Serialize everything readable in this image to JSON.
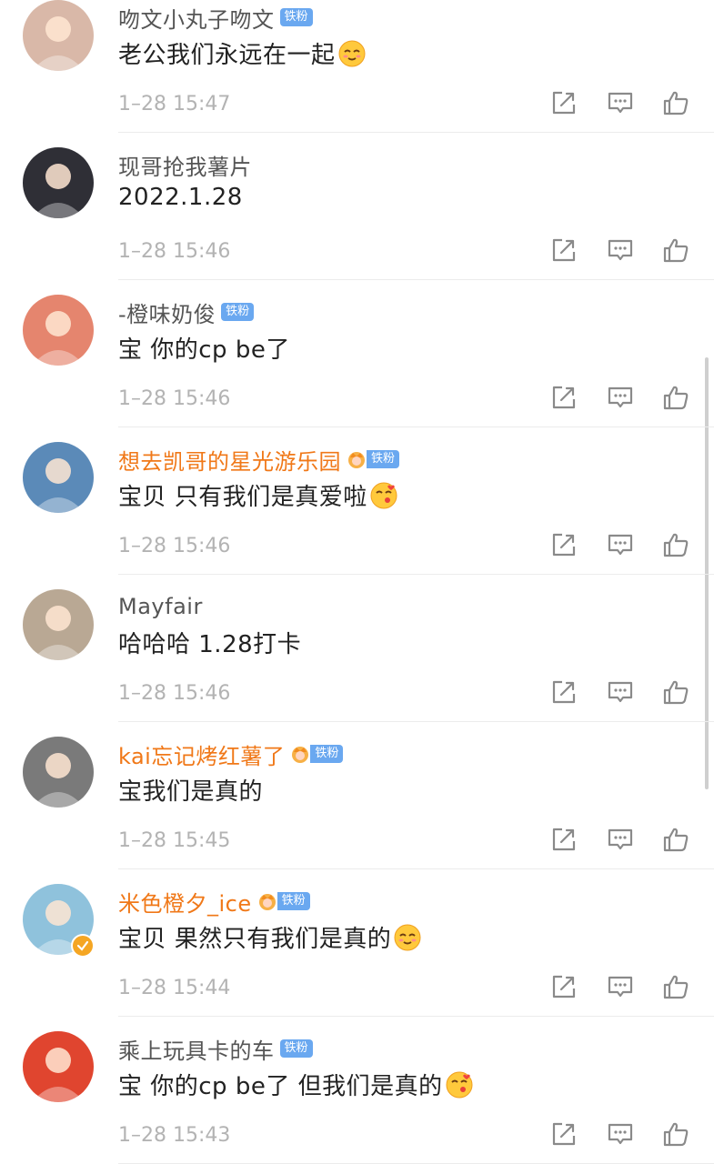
{
  "comments": [
    {
      "username": "吻文小丸子吻文",
      "vip": false,
      "crown": false,
      "fan_badge": "铁粉",
      "content": "老公我们永远在一起",
      "emoji": "smile-emoji",
      "time": "1–28 15:47",
      "avatar_color": "#d9b8a8"
    },
    {
      "username": "现哥抢我薯片",
      "vip": false,
      "crown": false,
      "fan_badge": "",
      "content": "2022.1.28",
      "emoji": "",
      "time": "1–28 15:46",
      "avatar_color": "#2f2f36"
    },
    {
      "username": "-橙味奶俊",
      "vip": false,
      "crown": false,
      "fan_badge": "铁粉",
      "content": "宝 你的cp be了",
      "emoji": "",
      "time": "1–28 15:46",
      "avatar_color": "#e5856e"
    },
    {
      "username": "想去凯哥的星光游乐园",
      "vip": true,
      "crown": true,
      "fan_badge": "铁粉",
      "content": "宝贝 只有我们是真爱啦",
      "emoji": "kiss-emoji",
      "time": "1–28 15:46",
      "avatar_color": "#5b8ab8"
    },
    {
      "username": "Mayfair",
      "vip": false,
      "crown": false,
      "fan_badge": "",
      "content": "哈哈哈 1.28打卡",
      "emoji": "",
      "time": "1–28 15:46",
      "avatar_color": "#b9a894"
    },
    {
      "username": "kai忘记烤红薯了",
      "vip": true,
      "crown": true,
      "fan_badge": "铁粉",
      "content": "宝我们是真的",
      "emoji": "",
      "time": "1–28 15:45",
      "avatar_color": "#7a7a7a"
    },
    {
      "username": "米色橙夕_ice",
      "vip": true,
      "crown": true,
      "fan_badge": "铁粉",
      "verified": true,
      "content": "宝贝 果然只有我们是真的",
      "emoji": "smile-emoji",
      "time": "1–28 15:44",
      "avatar_color": "#8fc2dc"
    },
    {
      "username": "乘上玩具卡的车",
      "vip": false,
      "crown": false,
      "fan_badge": "铁粉",
      "content": "宝 你的cp be了 但我们是真的",
      "emoji": "kiss-emoji",
      "time": "1–28 15:43",
      "avatar_color": "#e0452f"
    }
  ],
  "colors": {
    "vip_name": "#f07818",
    "normal_name": "#555555",
    "fan_badge": "#6aa8f0",
    "timestamp": "#b3b3b3"
  }
}
